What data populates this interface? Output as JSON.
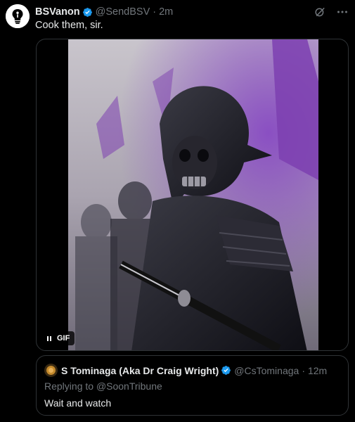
{
  "tweet": {
    "author_name": "BSVanon",
    "handle": "@SendBSV",
    "separator": "·",
    "time": "2m",
    "text": "Cook them, sir.",
    "avatar_icon": "lightbulb-icon",
    "verified_color": "#1d9bf0"
  },
  "media": {
    "type": "gif",
    "badge_label": "GIF",
    "pause_icon": "pause-icon",
    "depiction": "skull-faced armored samurai warriors with swords, purple smoke in background"
  },
  "quote": {
    "author_name": "S Tominaga (Aka Dr Craig Wright)",
    "handle": "@CsTominaga",
    "separator": "·",
    "time": "12m",
    "reply_prefix": "Replying to ",
    "reply_to": "@SoonTribune",
    "text": "Wait and watch"
  },
  "icons": {
    "grok": "grok-icon",
    "more": "more-icon"
  },
  "colors": {
    "background": "#000000",
    "text": "#e7e9ea",
    "secondary_text": "#71767b",
    "border": "#2f3336",
    "link": "#1d9bf0",
    "smoke": "#8a4fc2"
  }
}
